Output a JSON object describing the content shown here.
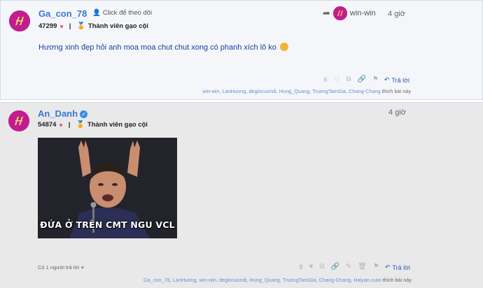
{
  "post1": {
    "username": "Ga_con_78",
    "follow_label": "Click để theo dõi",
    "points": "47299",
    "rank": "Thành viên gạo cội",
    "reply_to_label": "win-win",
    "time": "4 giờ",
    "content": "Hương xinh đẹp hỏi anh moa moa chut chut xong có phanh xích lô ko",
    "like_count": "6",
    "reply_label": "Trả lời",
    "likers": "win-win, LanHuong, degiocuondi, Hung_Quang, TruongTamGia, Chang-Chang",
    "likers_suffix": "thích bài này"
  },
  "post2": {
    "username": "An_Danh",
    "points": "54874",
    "rank": "Thành viên gạo cội",
    "time": "4 giờ",
    "meme_caption": "ĐỨA Ở TRÊN CMT NGU VCL",
    "liked_note": "Có 1 người trả lời",
    "like_count": "8",
    "reply_label": "Trả lời",
    "likers": "Ga_con_78, LanHuong, win-win, degiocuondi, Hung_Quang, TruongTamGia, Chang-Chang, Haiyan.ruan",
    "likers_suffix": "thích bài này"
  },
  "colors": {
    "accent": "#3a79d6",
    "avatar": "#c21d8f",
    "heart": "#e0567d"
  }
}
